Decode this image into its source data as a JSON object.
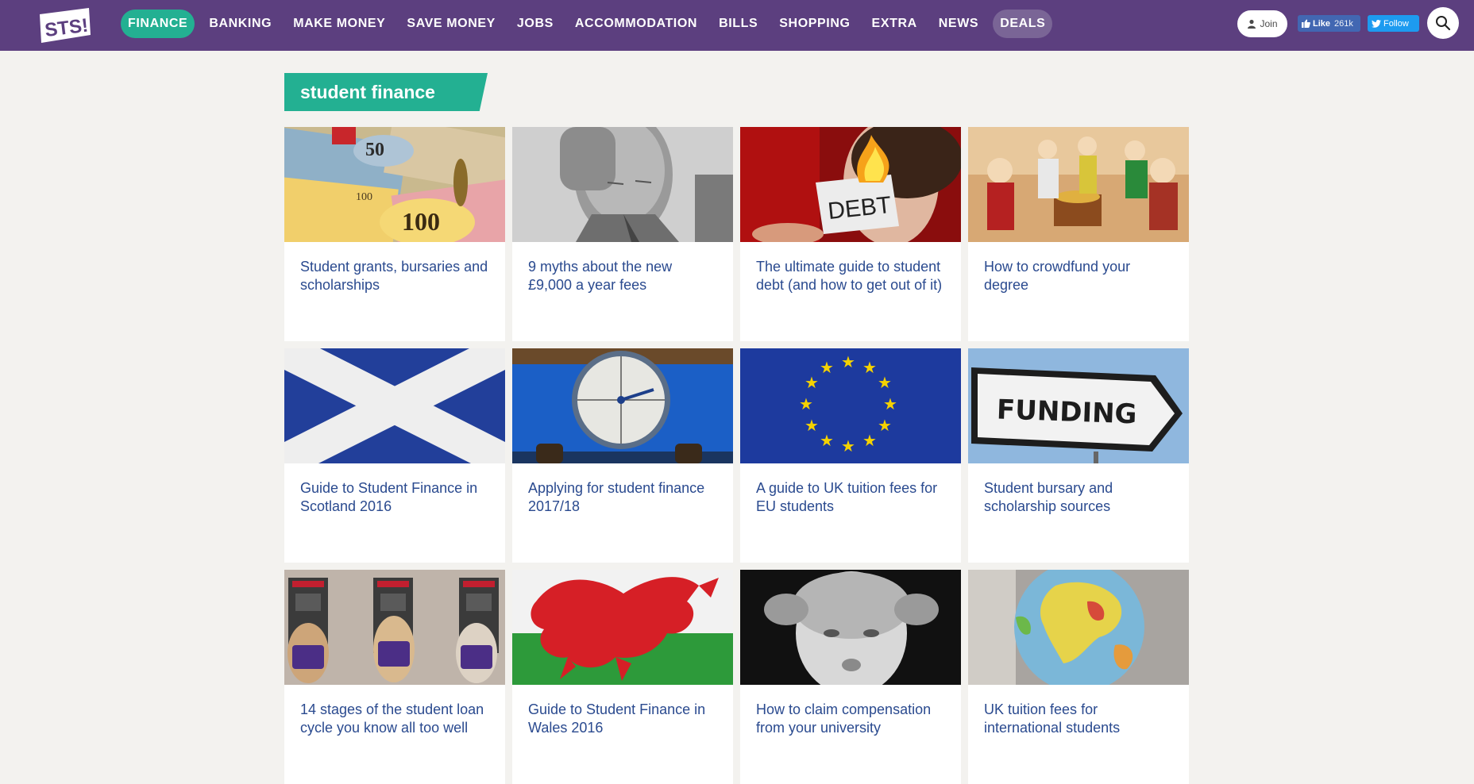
{
  "header": {
    "logo_text": "STS!",
    "nav": [
      {
        "label": "FINANCE",
        "state": "active"
      },
      {
        "label": "BANKING"
      },
      {
        "label": "MAKE MONEY"
      },
      {
        "label": "SAVE MONEY"
      },
      {
        "label": "JOBS"
      },
      {
        "label": "ACCOMMODATION"
      },
      {
        "label": "BILLS"
      },
      {
        "label": "SHOPPING"
      },
      {
        "label": "EXTRA"
      },
      {
        "label": "NEWS"
      },
      {
        "label": "DEALS",
        "state": "highlight"
      }
    ],
    "join_label": "Join",
    "fb_like_label": "Like",
    "fb_like_count": "261k",
    "twitter_follow_label": "Follow"
  },
  "section": {
    "title": "student finance"
  },
  "colors": {
    "header_bg": "#5c3f7f",
    "accent": "#23b092",
    "link": "#2a4a8f",
    "page_bg": "#f3f2ef"
  },
  "articles": [
    {
      "title": "Student grants, bursaries and scholarships",
      "image": "monopoly-money"
    },
    {
      "title": "9 myths about the new £9,000 a year fees",
      "image": "stressed-man"
    },
    {
      "title": "The ultimate guide to student debt (and how to get out of it)",
      "image": "burning-debt"
    },
    {
      "title": "How to crowdfund your degree",
      "image": "toy-figures-treasure"
    },
    {
      "title": "Guide to Student Finance in Scotland 2016",
      "image": "scotland-flag"
    },
    {
      "title": "Applying for student finance 2017/18",
      "image": "countdown-clock"
    },
    {
      "title": "A guide to UK tuition fees for EU students",
      "image": "eu-flag"
    },
    {
      "title": "Student bursary and scholarship sources",
      "image": "funding-sign"
    },
    {
      "title": "14 stages of the student loan cycle you know all too well",
      "image": "dogs-at-atms"
    },
    {
      "title": "Guide to Student Finance in Wales 2016",
      "image": "wales-flag"
    },
    {
      "title": "How to claim compensation from your university",
      "image": "grumpy-child"
    },
    {
      "title": "UK tuition fees for international students",
      "image": "globe"
    }
  ]
}
